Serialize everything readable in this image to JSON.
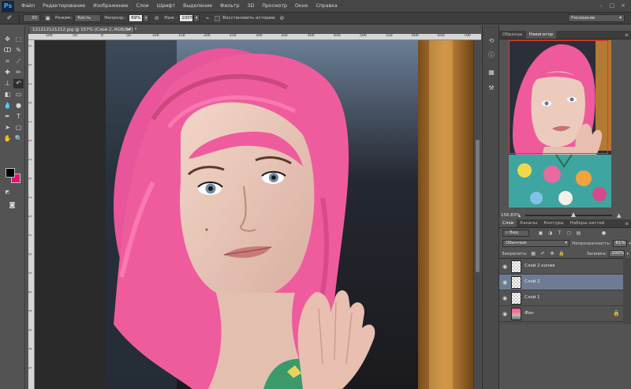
{
  "app": {
    "logo": "Ps",
    "menu": [
      "Файл",
      "Редактирование",
      "Изображение",
      "Слои",
      "Шрифт",
      "Выделение",
      "Фильтр",
      "3D",
      "Просмотр",
      "Окно",
      "Справка"
    ],
    "window_controls": [
      "–",
      "□",
      "×"
    ]
  },
  "options_bar": {
    "brush_size": "30",
    "mode_label": "Режим:",
    "mode_value": "Кисть",
    "opacity_label": "Непрозр.:",
    "opacity_value": "69%",
    "pressure_label": "Наж.:",
    "pressure_value": "100%",
    "history_label": "Восстановить историю",
    "workspace": "Рисование"
  },
  "document": {
    "tab_title": "121212121212.jpg @ 157% (Слой 2, RGB/8#) *",
    "ruler_top_labels": [
      "100",
      "50",
      "0",
      "50",
      "100",
      "150",
      "200",
      "250",
      "300",
      "350",
      "400",
      "450",
      "500",
      "550",
      "600",
      "650",
      "700"
    ],
    "ruler_left_labels": [
      "0",
      "5",
      "1",
      "0",
      "1",
      "5",
      "2",
      "0",
      "2",
      "5",
      "3",
      "0",
      "3",
      "5",
      "4",
      "0",
      "4",
      "5"
    ]
  },
  "navigator": {
    "tabs": [
      "Образцы",
      "Навигатор"
    ],
    "zoom": "156.83%"
  },
  "layers_panel": {
    "tabs": [
      "Слои",
      "Каналы",
      "Контуры",
      "Наборы кистей"
    ],
    "filter_label": "Вид",
    "blend_mode": "Обычные",
    "opacity_label": "Непрозрачность:",
    "opacity_value": "61%",
    "lock_label": "Закрепить:",
    "fill_label": "Заливка:",
    "fill_value": "100%",
    "layers": [
      {
        "name": "Слой 2 копия",
        "selected": false
      },
      {
        "name": "Слой 2",
        "selected": true
      },
      {
        "name": "Слой 1",
        "selected": false
      },
      {
        "name": "Фон",
        "selected": false
      }
    ]
  },
  "colors": {
    "foreground": "#000000",
    "background": "#e8106e",
    "hair": "#f0508f"
  }
}
